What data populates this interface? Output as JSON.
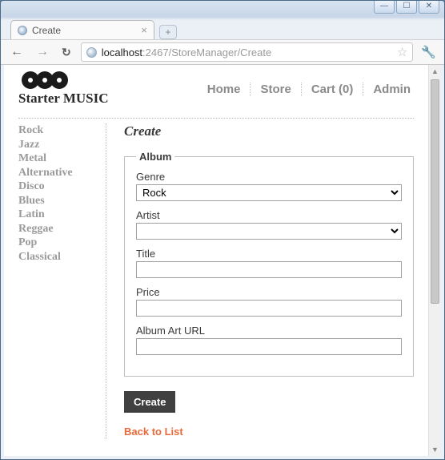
{
  "browser": {
    "tab_title": "Create",
    "url_host": "localhost",
    "url_rest": ":2467/StoreManager/Create"
  },
  "brand": {
    "title": "Starter MUSIC"
  },
  "topnav": {
    "home": "Home",
    "store": "Store",
    "cart": "Cart (0)",
    "admin": "Admin"
  },
  "sidebar": {
    "items": [
      "Rock",
      "Jazz",
      "Metal",
      "Alternative",
      "Disco",
      "Blues",
      "Latin",
      "Reggae",
      "Pop",
      "Classical"
    ]
  },
  "main": {
    "heading": "Create",
    "legend": "Album",
    "labels": {
      "genre": "Genre",
      "artist": "Artist",
      "title": "Title",
      "price": "Price",
      "art_url": "Album Art URL"
    },
    "values": {
      "genre": "Rock",
      "artist": "",
      "title": "",
      "price": "",
      "art_url": ""
    },
    "submit": "Create",
    "back": "Back to List"
  }
}
